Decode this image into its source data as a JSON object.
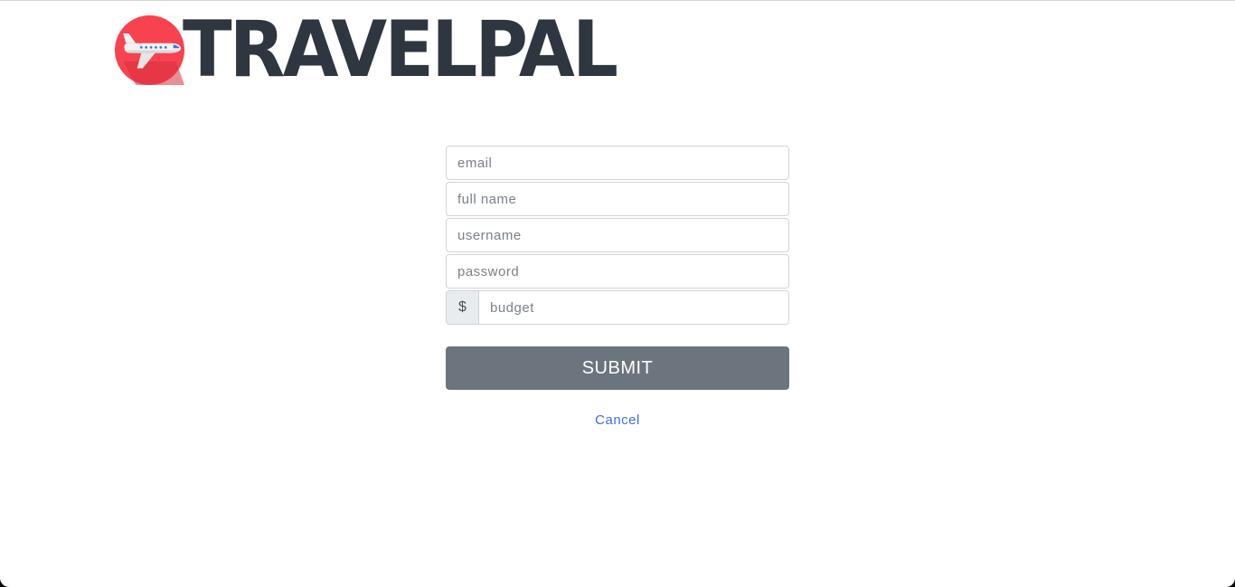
{
  "brand": {
    "name": "TRAVELPAL",
    "logo_icon": "airplane-icon",
    "colors": {
      "badge": "#f7434f",
      "text": "#2e3740"
    }
  },
  "signup_form": {
    "email_placeholder": "email",
    "full_name_placeholder": "full name",
    "username_placeholder": "username",
    "password_placeholder": "password",
    "currency_symbol": "$",
    "budget_placeholder": "budget",
    "submit_label": "SUBMIT",
    "cancel_label": "Cancel",
    "colors": {
      "submit_bg": "#6c757d",
      "link": "#3f6fd8"
    }
  }
}
